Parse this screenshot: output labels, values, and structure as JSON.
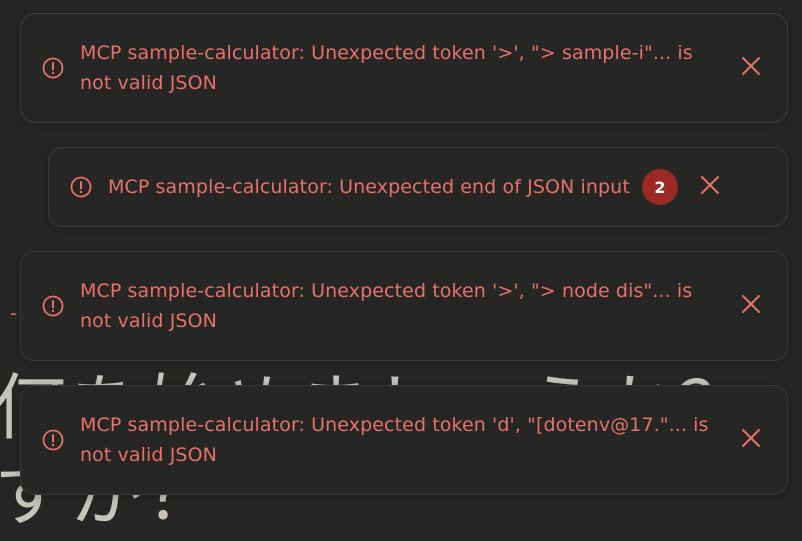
{
  "colors": {
    "background": "#262624",
    "toast_border": "#3a3a37",
    "error_text": "#e8716a",
    "badge": "#9b2a24"
  },
  "background_text": {
    "line1": "何を始めましょうか？",
    "line2": "すか？"
  },
  "toasts": [
    {
      "icon": "alert-circle-icon",
      "message": "MCP sample-calculator: Unexpected token '>', \"> sample-i\"... is not valid JSON",
      "close_icon": "close-icon"
    },
    {
      "icon": "alert-circle-icon",
      "message": "MCP sample-calculator: Unexpected end of JSON input",
      "count": "2",
      "close_icon": "close-icon"
    },
    {
      "icon": "alert-circle-icon",
      "message": "MCP sample-calculator: Unexpected token '>', \"> node dis\"... is not valid JSON",
      "close_icon": "close-icon"
    },
    {
      "icon": "alert-circle-icon",
      "message": "MCP sample-calculator: Unexpected token 'd', \"[dotenv@17.\"... is not valid JSON",
      "close_icon": "close-icon"
    }
  ]
}
